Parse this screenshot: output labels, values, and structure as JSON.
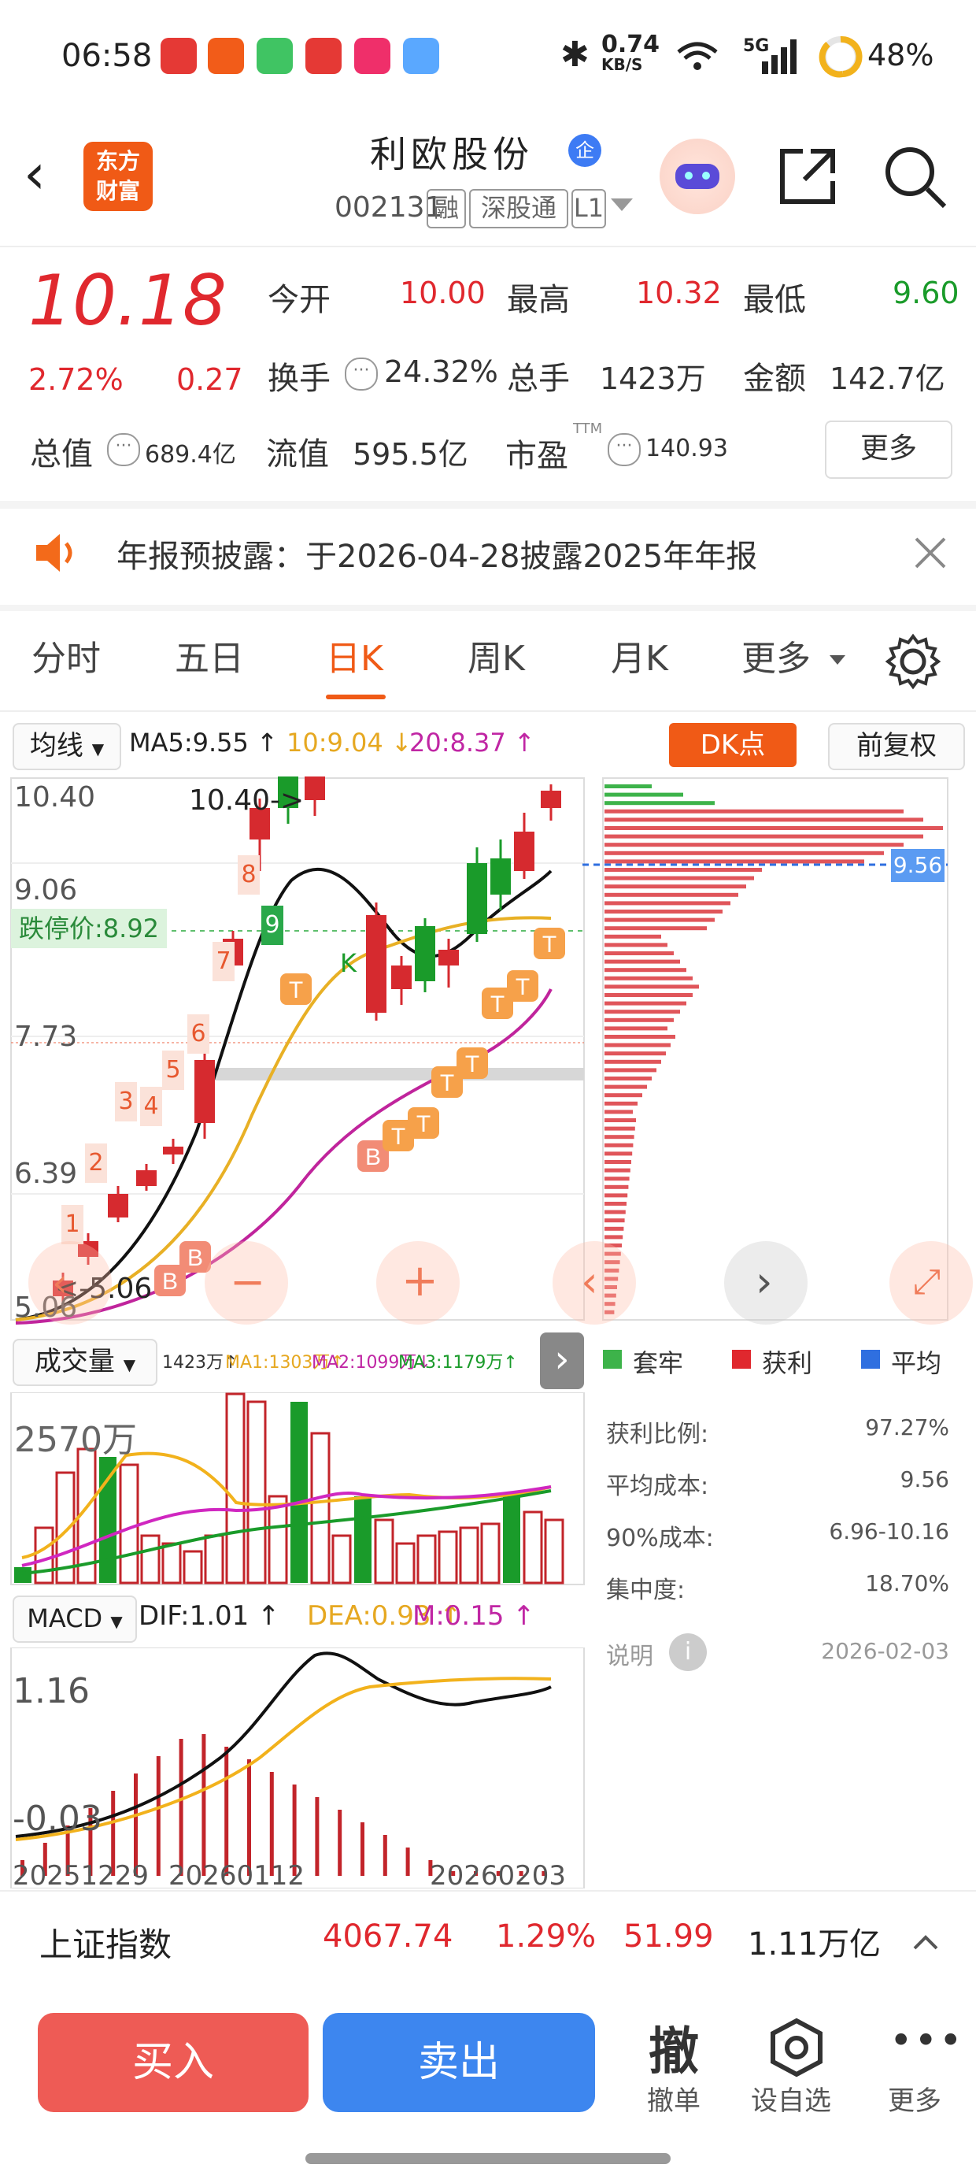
{
  "status_bar": {
    "time": "06:58",
    "net_speed": "0.74",
    "net_unit": "KB/S",
    "signal": "5G",
    "battery": "48%"
  },
  "header": {
    "logo_line1": "东方",
    "logo_line2": "财富",
    "stock_name": "利欧股份",
    "enterprise_badge": "企",
    "stock_code": "002131",
    "tags": [
      "融",
      "深股通",
      "L1"
    ]
  },
  "quote": {
    "price": "10.18",
    "change_pct": "2.72%",
    "change": "0.27",
    "open_label": "今开",
    "open": "10.00",
    "high_label": "最高",
    "high": "10.32",
    "low_label": "最低",
    "low": "9.60",
    "turnover_label": "换手",
    "turnover": "24.32%",
    "volume_label": "总手",
    "volume": "1423万",
    "amount_label": "金额",
    "amount": "142.7亿",
    "mktcap_label": "总值",
    "mktcap": "689.4亿",
    "float_label": "流值",
    "float": "595.5亿",
    "pe_label": "市盈",
    "pe_sup": "TTM",
    "pe": "140.93",
    "more_label": "更多"
  },
  "notice": {
    "text": "年报预披露：于2026-04-28披露2025年年报"
  },
  "tabs": [
    "分时",
    "五日",
    "日K",
    "周K",
    "月K",
    "更多"
  ],
  "active_tab": "日K",
  "ma_bar": {
    "selector": "均线",
    "ma5": "MA5:9.55 ↑",
    "ma10": "10:9.04 ↓",
    "ma20": "20:8.37 ↑",
    "dk_button": "DK点",
    "adjust_button": "前复权"
  },
  "kline": {
    "price_labels": [
      "10.40",
      "9.06",
      "7.73",
      "6.39",
      "5.06"
    ],
    "limit_down_label": "跌停价:8.92",
    "callout_high": "10.40->",
    "callout_low": "<-5.06",
    "chip_current": "9.56",
    "count_labels": [
      "1",
      "2",
      "3",
      "4",
      "5",
      "6",
      "7",
      "8",
      "9"
    ],
    "k_label": "K",
    "b_label": "B",
    "t_label": "T"
  },
  "volume_bar": {
    "selector": "成交量",
    "vol": "1423万↑",
    "ma1": "MA1:1303万↑",
    "ma2": "MA2:1099万↓",
    "ma3": "MA3:1179万↑",
    "max_label": "2570万"
  },
  "macd_bar": {
    "selector": "MACD",
    "dif": "DIF:1.01 ↑",
    "dea": "DEA:0.93 ↑",
    "m": "M:0.15 ↑",
    "top_label": "1.16",
    "bottom_label": "-0.03"
  },
  "dates": [
    "20251229",
    "20260112",
    "20260203"
  ],
  "chips": {
    "legend": [
      "套牢",
      "获利",
      "平均"
    ],
    "rows": [
      {
        "label": "获利比例:",
        "value": "97.27%"
      },
      {
        "label": "平均成本:",
        "value": "9.56"
      },
      {
        "label": "90%成本:",
        "value": "6.96-10.16"
      },
      {
        "label": "集中度:",
        "value": "18.70%"
      }
    ],
    "note_label": "说明",
    "note_date": "2026-02-03"
  },
  "index_bar": {
    "name": "上证指数",
    "price": "4067.74",
    "pct": "1.29%",
    "chg": "51.99",
    "amount": "1.11万亿"
  },
  "actions": {
    "buy": "买入",
    "sell": "卖出",
    "cancel_icon": "撤",
    "cancel": "撤单",
    "watch": "设自选",
    "more": "更多"
  }
}
